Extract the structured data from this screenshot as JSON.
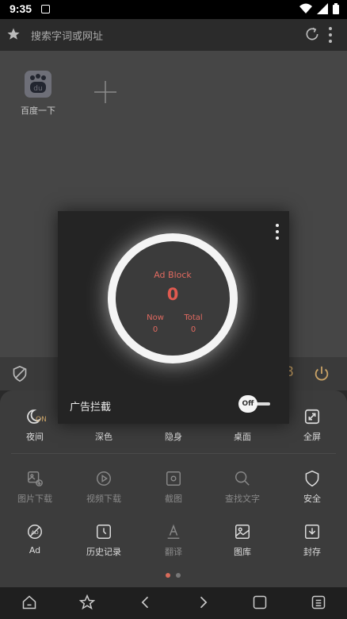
{
  "status_bar": {
    "time": "9:35"
  },
  "top_bar": {
    "search_placeholder": "搜索字词或网址"
  },
  "shortcuts": [
    {
      "label": "百度一下",
      "logo_text": "du"
    }
  ],
  "menu": {
    "row1": [
      {
        "label": "夜间",
        "badge": "ON",
        "icon": "moon-icon"
      },
      {
        "label": "深色",
        "icon": "dark-mode-icon"
      },
      {
        "label": "隐身",
        "icon": "incognito-icon"
      },
      {
        "label": "桌面",
        "icon": "desktop-icon"
      },
      {
        "label": "全屏",
        "icon": "fullscreen-icon"
      }
    ],
    "row2": [
      {
        "label": "图片下载",
        "icon": "image-download-icon"
      },
      {
        "label": "视频下载",
        "icon": "video-download-icon"
      },
      {
        "label": "截图",
        "icon": "screenshot-icon"
      },
      {
        "label": "查找文字",
        "icon": "search-icon"
      },
      {
        "label": "安全",
        "icon": "shield-icon"
      }
    ],
    "row3": [
      {
        "label": "Ad",
        "icon": "ad-block-icon"
      },
      {
        "label": "历史记录",
        "icon": "history-icon"
      },
      {
        "label": "翻译",
        "icon": "translate-icon"
      },
      {
        "label": "图库",
        "icon": "gallery-icon"
      },
      {
        "label": "封存",
        "icon": "archive-icon"
      }
    ],
    "page_count": 2,
    "current_page": 1
  },
  "ad_block": {
    "title": "Ad Block",
    "count": "0",
    "now_label": "Now",
    "now_value": "0",
    "total_label": "Total",
    "total_value": "0",
    "caption": "广告拦截",
    "toggle_label": "Off"
  },
  "colors": {
    "accent": "#d86b5a",
    "highlight": "#c9a266",
    "ring": "#f4f4f4"
  }
}
